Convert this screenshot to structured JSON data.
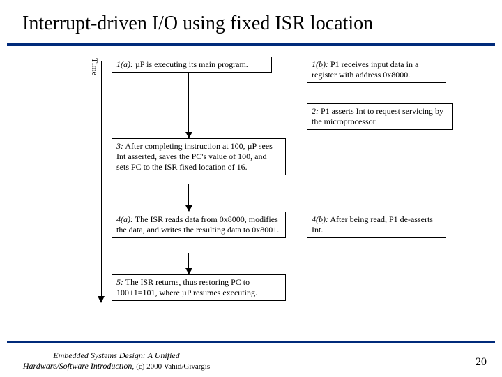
{
  "title": "Interrupt-driven I/O using fixed ISR location",
  "time_label": "Time",
  "nodes": {
    "n1a": {
      "lead": "1(a):",
      "text": " µP is executing its main program."
    },
    "n1b": {
      "lead": "1(b):",
      "text": " P1 receives input data in a register with address 0x8000."
    },
    "n2": {
      "lead": "2:",
      "text": " P1 asserts Int to request servicing by the microprocessor."
    },
    "n3": {
      "lead": "3:",
      "text": " After completing instruction at 100, µP sees Int asserted, saves the PC's value of 100, and sets PC to the ISR fixed location of 16."
    },
    "n4a": {
      "lead": "4(a):",
      "text": " The ISR reads data from 0x8000, modifies the data, and writes the resulting data to 0x8001."
    },
    "n4b": {
      "lead": "4(b):",
      "text": " After being read, P1 de-asserts Int."
    },
    "n5": {
      "lead": "5:",
      "text": " The ISR returns, thus restoring PC to 100+1=101, where µP resumes executing."
    }
  },
  "footer": {
    "line1": "Embedded Systems Design: A Unified",
    "line2": "Hardware/Software Introduction,",
    "copyright": " (c) 2000 Vahid/Givargis"
  },
  "page_number": "20"
}
